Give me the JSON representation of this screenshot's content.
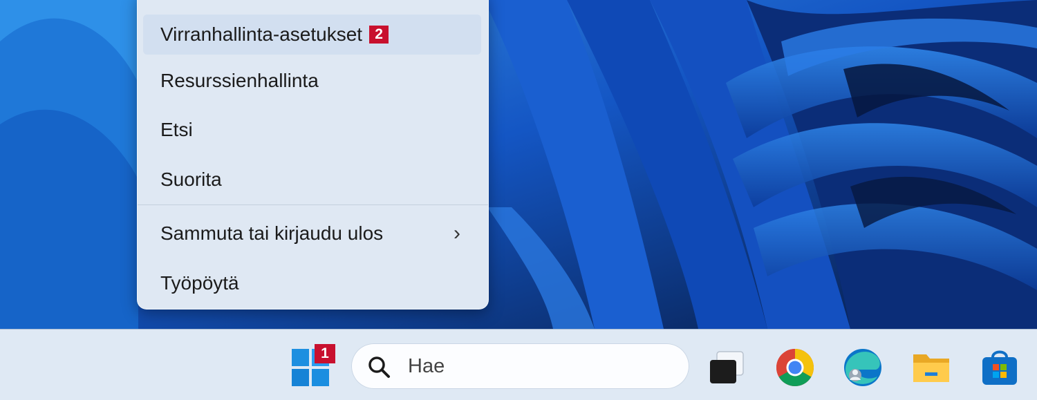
{
  "context_menu": {
    "items": [
      {
        "label": "Virranhallinta-asetukset",
        "badge": "2"
      },
      {
        "label": "Resurssienhallinta"
      },
      {
        "label": "Etsi"
      },
      {
        "label": "Suorita"
      },
      {
        "label": "Sammuta tai kirjaudu ulos"
      },
      {
        "label": "Työpöytä"
      }
    ]
  },
  "taskbar": {
    "start_badge": "1",
    "search_placeholder": "Hae",
    "icons": [
      "start-icon",
      "task-view-icon",
      "chrome-icon",
      "edge-icon",
      "file-explorer-icon",
      "store-icon"
    ]
  },
  "colors": {
    "badge": "#c8102e",
    "wallpaper": "#0a2a66",
    "accent": "#1d8fe0"
  }
}
